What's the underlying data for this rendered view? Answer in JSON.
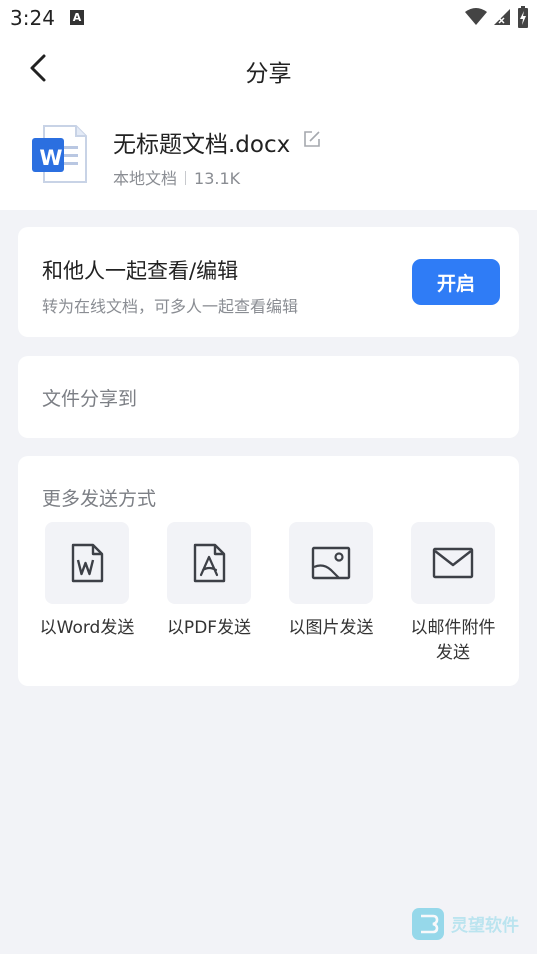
{
  "status_bar": {
    "time": "3:24",
    "notification_icon": "A"
  },
  "header": {
    "title": "分享",
    "back_icon": "chevron-left"
  },
  "file": {
    "name": "无标题文档.docx",
    "location": "本地文档",
    "size": "13.1K",
    "icon_letter": "W"
  },
  "collab": {
    "title": "和他人一起查看/编辑",
    "subtitle": "转为在线文档，可多人一起查看编辑",
    "button": "开启"
  },
  "share_to": {
    "label": "文件分享到"
  },
  "more": {
    "title": "更多发送方式",
    "options": [
      {
        "label": "以Word发送",
        "icon": "word-file-icon"
      },
      {
        "label": "以PDF发送",
        "icon": "pdf-file-icon"
      },
      {
        "label": "以图片发送",
        "icon": "image-icon"
      },
      {
        "label": "以邮件附件发送",
        "icon": "mail-icon"
      }
    ]
  },
  "watermark": {
    "text": "灵望软件"
  },
  "colors": {
    "accent": "#2f7cf6",
    "background": "#f2f3f7",
    "word_blue": "#2b6fe0"
  }
}
